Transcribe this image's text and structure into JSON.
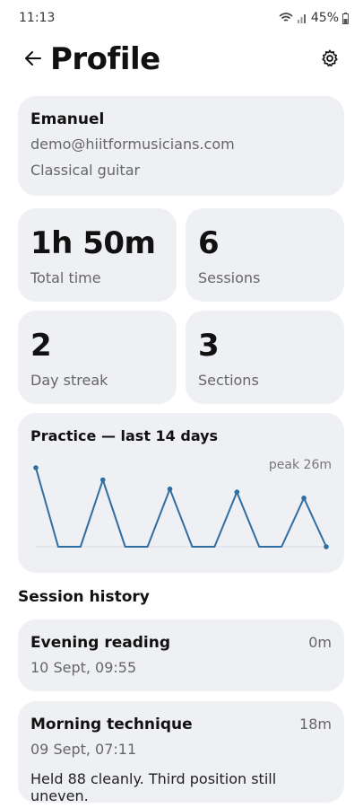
{
  "status": {
    "time": "11:13",
    "battery": "45%"
  },
  "header": {
    "title": "Profile",
    "back_icon": "arrow-left-icon",
    "settings_icon": "gear-icon"
  },
  "profile": {
    "name": "Emanuel",
    "email": "demo@hiitformusicians.com",
    "instrument": "Classical guitar"
  },
  "stats": [
    {
      "value": "1h 50m",
      "label": "Total time"
    },
    {
      "value": "6",
      "label": "Sessions"
    },
    {
      "value": "2",
      "label": "Day streak"
    },
    {
      "value": "3",
      "label": "Sections"
    }
  ],
  "chart_data": {
    "type": "line",
    "title": "Practice — last 14 days",
    "annotation": "peak 26m",
    "unit": "minutes",
    "x": [
      1,
      2,
      3,
      4,
      5,
      6,
      7,
      8,
      9,
      10,
      11,
      12,
      13,
      14
    ],
    "values": [
      26,
      0,
      0,
      22,
      0,
      0,
      19,
      0,
      0,
      18,
      0,
      0,
      16,
      0
    ],
    "ylim": [
      0,
      26
    ],
    "grid": false,
    "line_color": "#2f6ea3"
  },
  "history": {
    "title": "Session history",
    "sessions": [
      {
        "name": "Evening reading",
        "duration": "0m",
        "date": "10 Sept, 09:55",
        "note": ""
      },
      {
        "name": "Morning technique",
        "duration": "18m",
        "date": "09 Sept, 07:11",
        "note": "Held 88 cleanly. Third position still uneven."
      }
    ]
  },
  "colors": {
    "card_bg": "#eef0f3",
    "accent_line": "#2f6ea3"
  }
}
